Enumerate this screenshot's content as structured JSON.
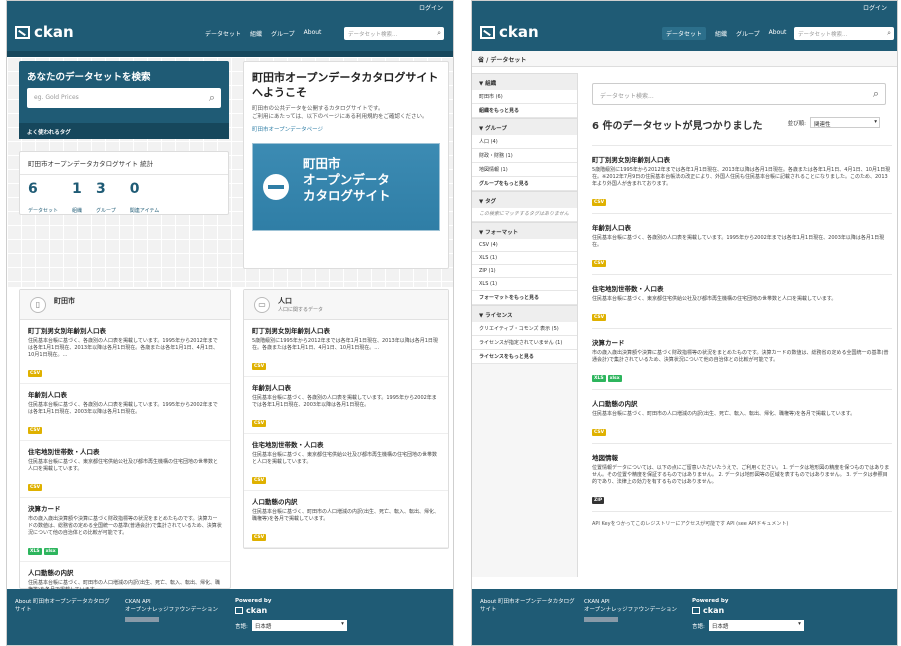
{
  "header": {
    "login": "ログイン",
    "logo": "ckan",
    "nav": [
      "データセット",
      "組織",
      "グループ",
      "About"
    ],
    "search_placeholder": "データセット検索..."
  },
  "home": {
    "search_title": "あなたのデータセットを検索",
    "search_placeholder": "eg. Gold Prices",
    "popular_tags": "よく使われるタグ",
    "stats_title": "町田市オープンデータカタログサイト 統計",
    "stats": [
      {
        "value": "6",
        "label": "データセット"
      },
      {
        "value": "1",
        "label": "組織"
      },
      {
        "value": "3",
        "label": "グループ"
      },
      {
        "value": "0",
        "label": "関連アイテム"
      }
    ],
    "welcome_title": "町田市オープンデータカタログサイトへようこそ",
    "welcome_text": "町田市の公共データを公開するカタログサイトです。",
    "welcome_text2": "ご利用にあたっては、以下のページにある利用規約をご確認ください。",
    "welcome_link": "町田市オープンデータページ",
    "banner_line1": "町田市",
    "banner_line2": "オープンデータ",
    "banner_line3": "カタログサイト",
    "org_card": {
      "title": "町田市",
      "datasets": [
        {
          "title": "町丁別男女別年齢別人口表",
          "desc": "住民基本台帳に基づく、各歳別の人口表を掲載しています。1995年から2012年までは各年1月1日現在、2013年以降は各月1日現在。各歳または各年1月1日、4月1日、10月1日現在。…",
          "formats": [
            "CSV"
          ]
        },
        {
          "title": "年齢別人口表",
          "desc": "住民基本台帳に基づく、各歳別の人口表を掲載しています。1995年から2002年までは各年1月1日現在、2003年以降は各月1日現在。",
          "formats": [
            "CSV"
          ]
        },
        {
          "title": "住宅地別世帯数・人口表",
          "desc": "住民基本台帳に基づく、東京都住宅供給公社及び都市再生機構の住宅団地の世帯数と人口を掲載しています。",
          "formats": [
            "CSV"
          ]
        },
        {
          "title": "決算カード",
          "desc": "市の歳入歳出決算額や決算に基づく財政指標等の状況をまとめたものです。決算カードの数値は、総務省の定める全国統一の基準(普通会計)で集計されているため、決算状況について他の自治体との比較が可能です。",
          "formats": [
            "XLS",
            "xlsx"
          ]
        },
        {
          "title": "人口動態の内訳",
          "desc": "住民基本台帳に基づく、町田市の人口増減の内訳(出生、死亡、転入、転出、帰化、職権等)を各月で掲載しています。",
          "formats": []
        }
      ]
    },
    "group_card": {
      "title": "人口",
      "subtitle": "人口に関するデータ",
      "datasets": [
        {
          "title": "町丁別男女別年齢別人口表",
          "desc": "5歳階級別に1995年から2012年までは各年1月1日現在、2013年以降は各月1日現在。各歳または各年1月1日、4月1日、10月1日現在。…",
          "formats": [
            "CSV"
          ]
        },
        {
          "title": "年齢別人口表",
          "desc": "住民基本台帳に基づく、各歳別の人口表を掲載しています。1995年から2002年までは各年1月1日現在、2003年以降は各月1日現在。",
          "formats": [
            "CSV"
          ]
        },
        {
          "title": "住宅地別世帯数・人口表",
          "desc": "住民基本台帳に基づく、東京都住宅供給公社及び都市再生機構の住宅団地の世帯数と人口を掲載しています。",
          "formats": [
            "CSV"
          ]
        },
        {
          "title": "人口動態の内訳",
          "desc": "住民基本台帳に基づく、町田市の人口増減の内訳(出生、死亡、転入、転出、帰化、職権等)を各月で掲載しています。",
          "formats": [
            "CSV"
          ]
        }
      ]
    }
  },
  "search_page": {
    "breadcrumb": "省 / データセット",
    "facets": [
      {
        "title": "組織",
        "items": [
          "町田市 (6)"
        ],
        "more": "組織をもっと見る"
      },
      {
        "title": "グループ",
        "items": [
          "人口 (4)",
          "財政・財務 (1)",
          "地図情報 (1)"
        ],
        "more": "グループをもっと見る"
      },
      {
        "title": "タグ",
        "items": [],
        "empty": "この検索にマッチするタグはありません",
        "more": ""
      },
      {
        "title": "フォーマット",
        "items": [
          "CSV (4)",
          "XLS (1)",
          "ZIP (1)",
          "XLS (1)"
        ],
        "more": "フォーマットをもっと見る"
      },
      {
        "title": "ライセンス",
        "items": [
          "クリエイティブ・コモンズ 表示 (5)",
          "ライセンスが指定されていません (1)"
        ],
        "more": "ライセンスをもっと見る"
      }
    ],
    "search_placeholder": "データセット検索...",
    "found": "6 件のデータセットが見つかりました",
    "order_label": "並び順:",
    "order_value": "関連性",
    "datasets": [
      {
        "title": "町丁別男女別年齢別人口表",
        "desc": "5歳階級別に1995年から2012年までは各年1月1日現在、2013年以降は各月1日現在。各歳または各年1月1日、4月1日、10月1日現在。※2012年7月9日の住民基本台帳法の改正により、外国人住民も住民基本台帳に記載されることになりました。このため、2013年より外国人が含まれております。",
        "formats": [
          "CSV"
        ]
      },
      {
        "title": "年齢別人口表",
        "desc": "住民基本台帳に基づく、各歳別の人口表を掲載しています。1995年から2002年までは各年1月1日現在、2003年以降は各月1日現在。",
        "formats": [
          "CSV"
        ]
      },
      {
        "title": "住宅地別世帯数・人口表",
        "desc": "住民基本台帳に基づく、東京都住宅供給公社及び都市再生機構の住宅団地の世帯数と人口を掲載しています。",
        "formats": [
          "CSV"
        ]
      },
      {
        "title": "決算カード",
        "desc": "市の歳入歳出決算額や決算に基づく財政指標等の状況をまとめたものです。決算カードの数値は、総務省の定める全国統一の基準(普通会計)で集計されているため、決算状況について他の自治体との比較が可能です。",
        "formats": [
          "XLS",
          "xlsx"
        ]
      },
      {
        "title": "人口動態の内訳",
        "desc": "住民基本台帳に基づく、町田市の人口増減の内訳(出生、死亡、転入、転出、帰化、職権等)を各月で掲載しています。",
        "formats": [
          "CSV"
        ]
      },
      {
        "title": "地図情報",
        "desc": "位置情報データについては、以下の点にご留意いただいたうえで、ご利用ください。 1. データは地形図の精度を保つものではありません。その位置や精度を保証するものではありません。 2. データは地形図等の区域を表すものではありません。 3. データは参照目的であり、法律上の効力を有するものではありません。",
        "formats": [
          "ZIP"
        ]
      }
    ],
    "api_note": "API Keyをつかってこのレジストリーにアクセスが可能です API (see APIドキュメント)"
  },
  "footer": {
    "about": "About 町田市オープンデータカタログサイト",
    "ckan_api": "CKAN API",
    "okf": "オープンナレッジファウンデーション",
    "powered_by": "Powered by",
    "ckan": "ckan",
    "lang_label": "言語:",
    "lang_value": "日本語"
  },
  "colors": {
    "primary": "#1f5b75",
    "csv": "#dfb100",
    "xls": "#2db55d",
    "zip": "#333333"
  }
}
